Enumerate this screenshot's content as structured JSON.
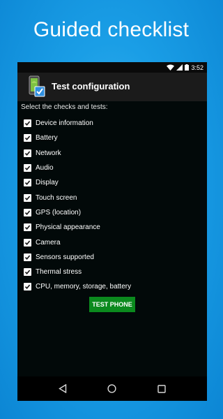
{
  "headline": "Guided checklist",
  "status_bar": {
    "time": "3:52"
  },
  "app_bar": {
    "title": "Test configuration"
  },
  "prompt": "Select the checks and tests:",
  "checklist": [
    {
      "label": "Device information",
      "checked": true
    },
    {
      "label": "Battery",
      "checked": true
    },
    {
      "label": "Network",
      "checked": true
    },
    {
      "label": "Audio",
      "checked": true
    },
    {
      "label": "Display",
      "checked": true
    },
    {
      "label": "Touch screen",
      "checked": true
    },
    {
      "label": "GPS (location)",
      "checked": true
    },
    {
      "label": "Physical appearance",
      "checked": true
    },
    {
      "label": "Camera",
      "checked": true
    },
    {
      "label": "Sensors supported",
      "checked": true
    },
    {
      "label": "Thermal stress",
      "checked": true
    },
    {
      "label": "CPU, memory, storage, battery",
      "checked": true
    }
  ],
  "test_button": {
    "label": "TEST PHONE"
  },
  "colors": {
    "background": "#1a9ee6",
    "screen": "#020909",
    "app_bar": "#1b1b1b",
    "button": "#0b8a1e"
  }
}
